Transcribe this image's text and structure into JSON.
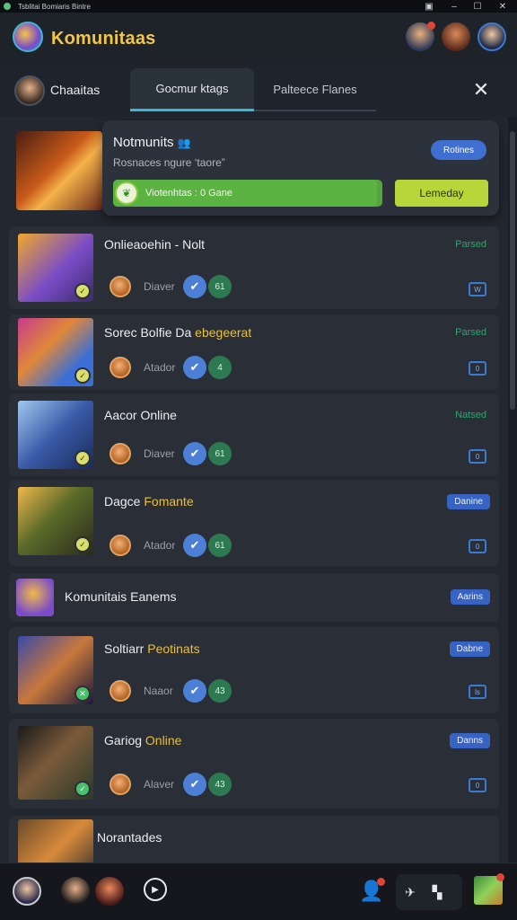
{
  "window": {
    "title": "Tsblitai Bomiaris Bintre",
    "controls": [
      "minimize-icon",
      "maximize-icon",
      "close-icon"
    ]
  },
  "app": {
    "title": "Komunitaas"
  },
  "tabs": {
    "chats_label": "Chaaitas",
    "active_label": "Gocmur ktags",
    "other_label": "Palteece Flanes"
  },
  "featured": {
    "title": "Notmunits",
    "subtitle": "Rosnaces ngure ‘taore”",
    "badge": "Rotines",
    "progress_text": "Viotenhtas : 0 Gane",
    "progress_value": 0.98,
    "action_button": "Lemeday"
  },
  "rows": [
    {
      "title": "Onlieaoehin - Nolt",
      "title_highlight": "",
      "status": "Parsed",
      "pill": "",
      "meta_name": "Diaver",
      "count": "61",
      "action": "W"
    },
    {
      "title": "Sorec Bolfie Da ",
      "title_highlight": "ebegeerat",
      "status": "Parsed",
      "pill": "",
      "meta_name": "Atador",
      "count": "4",
      "action": "0"
    },
    {
      "title": "Aacor Online",
      "title_highlight": "",
      "status": "Natsed",
      "pill": "",
      "meta_name": "Diaver",
      "count": "61",
      "action": "0"
    },
    {
      "title": "Dagce ",
      "title_highlight": "Fomante",
      "status": "",
      "pill": "Danine",
      "meta_name": "Atador",
      "count": "61",
      "action": "0"
    },
    {
      "title": "Soltiarr ",
      "title_highlight": "Peotinats",
      "status": "",
      "pill": "Dabne",
      "meta_name": "Naaor",
      "count": "43",
      "action": "ls"
    },
    {
      "title": "Gariog ",
      "title_highlight": "Online",
      "status": "",
      "pill": "Danns",
      "meta_name": "Alaver",
      "count": "43",
      "action": "0"
    }
  ],
  "group_row": {
    "title": "Komunitais Eanems",
    "pill": "Aarins"
  },
  "bottom_row": {
    "title": "Norantades"
  },
  "bottom_bar": {
    "notification_count": "1"
  }
}
